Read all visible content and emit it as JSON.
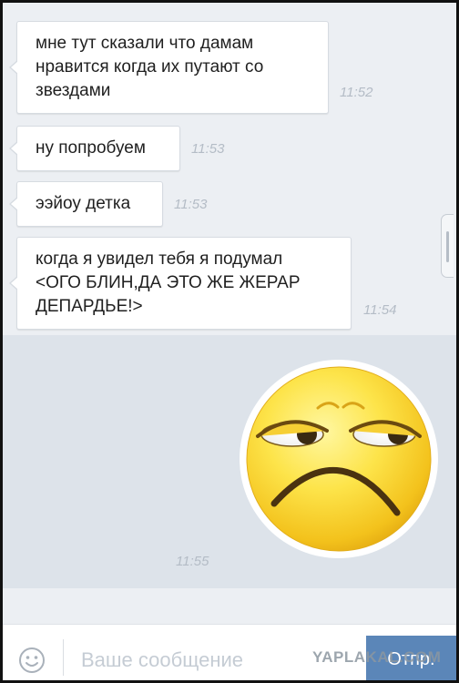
{
  "messages": [
    {
      "lines": [
        "мне тут сказали что дамам",
        "нравится когда их путают со",
        "звездами"
      ],
      "time": "11:52"
    },
    {
      "lines": [
        "ну попробуем"
      ],
      "time": "11:53"
    },
    {
      "lines": [
        "ээйоу детка"
      ],
      "time": "11:53"
    },
    {
      "lines": [
        "когда я увидел тебя я подумал",
        "<ОГО БЛИН,ДА ЭТО ЖЕ ЖЕРАР",
        "ДЕПАРДЬЕ!>"
      ],
      "time": "11:54"
    }
  ],
  "sticker": {
    "icon": "sad-smiley-sticker",
    "time": "11:55"
  },
  "composer": {
    "placeholder": "Ваше сообщение",
    "send_label": "Отпр.",
    "emoji_icon": "emoji-smile-icon"
  },
  "watermark": "YAPLAKAL.COM",
  "colors": {
    "chat_background": "#eceff3",
    "highlight_background": "#dde3ea",
    "bubble_background": "#ffffff",
    "time_text": "#b4bcc6",
    "send_button": "#5b86b8"
  }
}
